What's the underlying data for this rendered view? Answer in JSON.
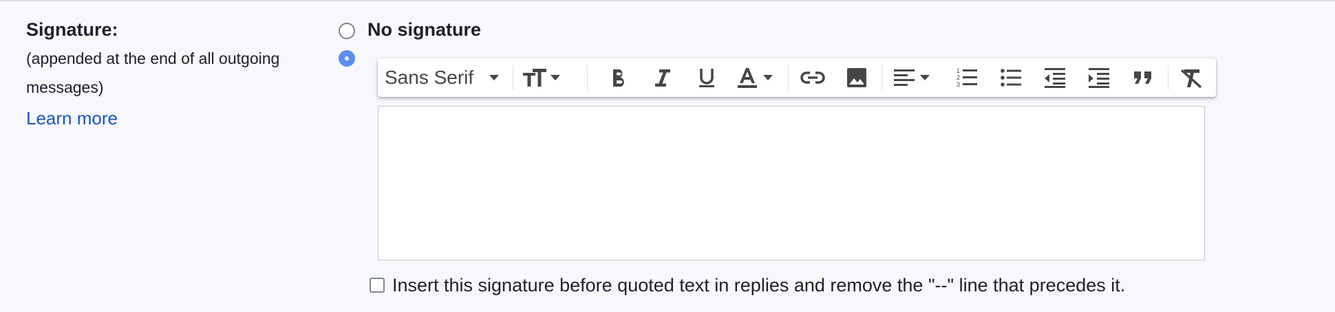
{
  "signature": {
    "title": "Signature:",
    "description": "(appended at the end of all outgoing messages)",
    "learn_more": "Learn more",
    "no_signature_label": "No signature",
    "selected_option": "custom"
  },
  "toolbar": {
    "font_family": "Sans Serif",
    "buttons": [
      "font-size",
      "bold",
      "italic",
      "underline",
      "text-color",
      "link",
      "image",
      "align",
      "numbered-list",
      "bulleted-list",
      "indent-less",
      "indent-more",
      "quote",
      "remove-formatting"
    ]
  },
  "editor": {
    "content": ""
  },
  "insert_option": {
    "label": "Insert this signature before quoted text in replies and remove the \"--\" line that precedes it.",
    "checked": false
  },
  "colors": {
    "accent": "#5b8def",
    "link": "#1a54c8",
    "background": "#f6f8fc",
    "icon": "#444746"
  }
}
